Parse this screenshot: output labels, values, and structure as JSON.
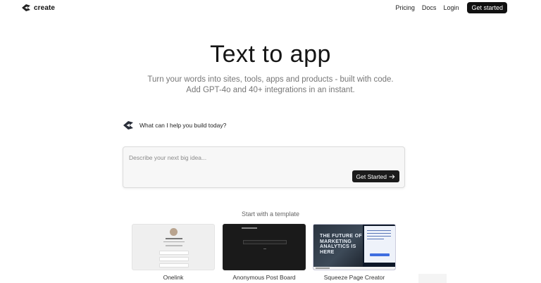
{
  "header": {
    "brand": "create",
    "nav": {
      "pricing": "Pricing",
      "docs": "Docs",
      "login": "Login",
      "cta": "Get started"
    }
  },
  "hero": {
    "title": "Text to app",
    "subtitle_line1": "Turn your words into sites, tools, apps and products - built with code.",
    "subtitle_line2": "Add GPT-4o and 40+ integrations in an instant."
  },
  "prompt": {
    "label": "What can I help you build today?",
    "placeholder": "Describe your next big idea...",
    "button": "Get Started",
    "button_icon": "arrow-right-icon"
  },
  "templates": {
    "heading": "Start with a template",
    "items": [
      {
        "name": "Onelink"
      },
      {
        "name": "Anonymous Post Board"
      },
      {
        "name": "Squeeze Page Creator",
        "thumb_headline": "THE FUTURE OF MARKETING ANALYTICS IS HERE"
      }
    ]
  },
  "colors": {
    "accent": "#111111",
    "muted_text": "#777777"
  }
}
